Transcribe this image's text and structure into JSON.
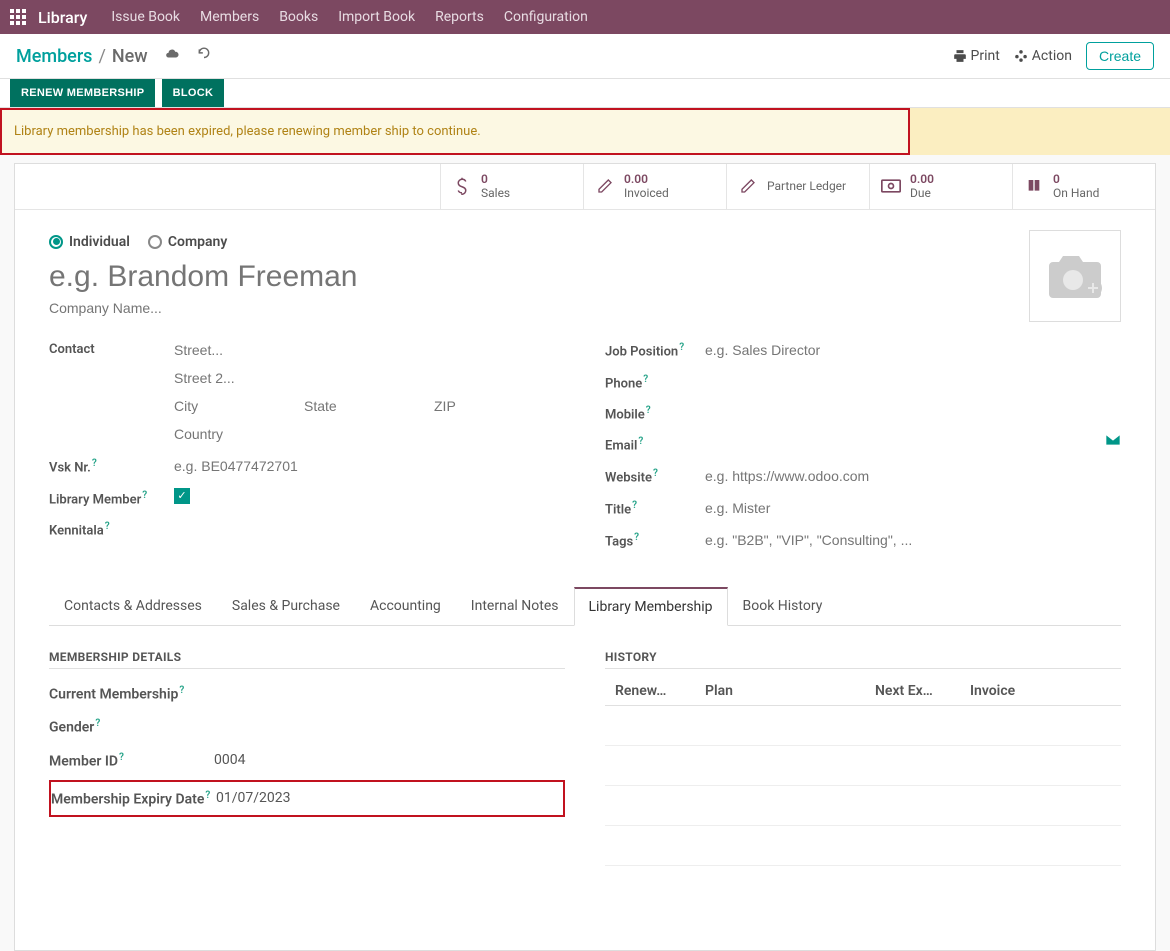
{
  "nav": {
    "brand": "Library",
    "items": [
      "Issue Book",
      "Members",
      "Books",
      "Import Book",
      "Reports",
      "Configuration"
    ]
  },
  "breadcrumb": {
    "parent": "Members",
    "current": "New",
    "print": "Print",
    "action": "Action",
    "create": "Create"
  },
  "status_buttons": {
    "renew": "RENEW MEMBERSHIP",
    "block": "BLOCK"
  },
  "alert": "Library membership has been expired, please renewing member ship to continue.",
  "stats": [
    {
      "icon": "dollar",
      "num": "0",
      "lbl": "Sales"
    },
    {
      "icon": "edit",
      "num": "0.00",
      "lbl": "Invoiced"
    },
    {
      "icon": "edit",
      "num": "",
      "lbl": "Partner Ledger"
    },
    {
      "icon": "money",
      "num": "0.00",
      "lbl": "Due"
    },
    {
      "icon": "book",
      "num": "0",
      "lbl": "On Hand"
    }
  ],
  "radios": {
    "individual": "Individual",
    "company": "Company"
  },
  "placeholders": {
    "name": "e.g. Brandom Freeman",
    "company": "Company Name...",
    "street": "Street...",
    "street2": "Street 2...",
    "city": "City",
    "state": "State",
    "zip": "ZIP",
    "country": "Country",
    "vsk": "e.g. BE0477472701",
    "job": "e.g. Sales Director",
    "website": "e.g. https://www.odoo.com",
    "title": "e.g. Mister",
    "tags": "e.g. \"B2B\", \"VIP\", \"Consulting\", ..."
  },
  "left_fields": {
    "contact": "Contact",
    "vsk": "Vsk Nr.",
    "library_member": "Library Member",
    "kennitala": "Kennitala"
  },
  "right_fields": {
    "job": "Job Position",
    "phone": "Phone",
    "mobile": "Mobile",
    "email": "Email",
    "website": "Website",
    "title": "Title",
    "tags": "Tags"
  },
  "tabs": [
    "Contacts & Addresses",
    "Sales & Purchase",
    "Accounting",
    "Internal Notes",
    "Library Membership",
    "Book History"
  ],
  "membership": {
    "section_title": "MEMBERSHIP DETAILS",
    "current": "Current Membership",
    "gender": "Gender",
    "member_id_lbl": "Member ID",
    "member_id_val": "0004",
    "expiry_lbl": "Membership Expiry Date",
    "expiry_val": "01/07/2023"
  },
  "history": {
    "section_title": "HISTORY",
    "cols": {
      "renew": "Renew…",
      "plan": "Plan",
      "exp": "Next Ex…",
      "inv": "Invoice"
    }
  }
}
